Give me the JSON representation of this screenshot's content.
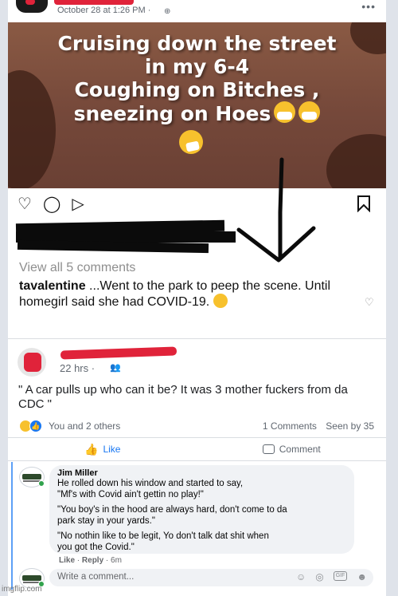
{
  "post": {
    "time": "October 28 at 1:26 PM ·",
    "globe_icon": "globe-icon",
    "more_icon": "more-horizontal-icon"
  },
  "meme": {
    "lines": [
      "Cruising down the street",
      "in my 6-4",
      "Coughing on Bitches ,",
      "sneezing on Hoes"
    ],
    "emojis": [
      "mask-face-emoji",
      "mask-face-emoji",
      "sneezing-face-emoji"
    ]
  },
  "instagram": {
    "icons": [
      "heart-icon",
      "comment-icon",
      "share-icon",
      "bookmark-icon"
    ],
    "view_all": "View all 5 comments",
    "comment_user": "tavalentine",
    "comment_text": "...Went to the park to peep the scene. Until homegirl said she had COVID-19.",
    "comment_emoji": "grinning-emoji"
  },
  "fb_post": {
    "time": "22 hrs ·",
    "text": "\" A car pulls up who can it be? It was 3 mother fuckers from da CDC \"",
    "reactions_text": "You and 2 others",
    "comments_count": "1 Comments",
    "seen_by": "Seen by 35",
    "like_label": "Like",
    "comment_label": "Comment"
  },
  "comment": {
    "author": "Jim Miller",
    "lines": [
      "He rolled down his window and started to say,",
      "\"Mf's with Covid ain't gettin no play!\"",
      "\"You boy's in the hood are always hard, don't come to da",
      "park stay in your yards.\"",
      "\"No nothin like to be legit, Yo don't talk dat shit when",
      "you got the Covid.\""
    ],
    "like": "Like",
    "reply": "Reply",
    "age": "6m"
  },
  "write_comment": {
    "placeholder": "Write a comment..."
  },
  "watermark": "imgflip.com"
}
